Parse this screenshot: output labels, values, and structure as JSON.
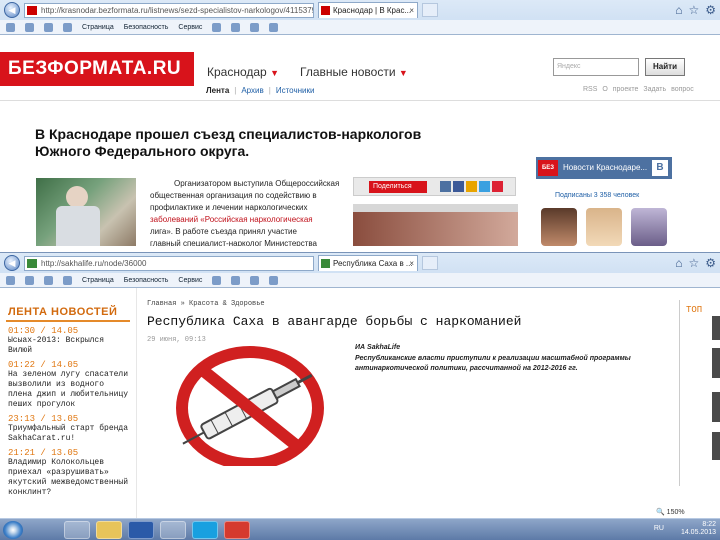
{
  "browser1": {
    "address": "http://krasnodar.bezformata.ru/listnews/sezd-specialistov-narkologov/4115379/",
    "tab_title": "Краснодар | В Крас...",
    "commands": [
      "Страница",
      "Безопасность",
      "Сервис"
    ]
  },
  "site1": {
    "logo": "БЕЗФОРМАТА.RU",
    "city": "Краснодар",
    "main_news": "Главные новости",
    "search_placeholder": "Яндекс",
    "search_button": "Найти",
    "subnav": [
      "Лента",
      "Архив",
      "Источники"
    ],
    "top_links": [
      "RSS",
      "О проекте",
      "Задать вопрос"
    ],
    "headline": "В Краснодаре прошел съезд специалистов-наркологов Южного Федерального округа.",
    "body_lines": [
      "Организатором выступила Общероссийская",
      "общественная организация по содействию в",
      "профилактике и лечении наркологических",
      "заболеваний «Российская наркологическая",
      "лига». В работе съезда принял участие",
      "главный специалист-нарколог Министерства"
    ],
    "share_label": "Поделиться",
    "vk_widget_title": "Новости Краснодаре...",
    "vk_logo_small": "БЕЗ",
    "vk_letter": "В",
    "subscribers": "Подписаны 3 358 человек"
  },
  "browser2": {
    "address": "http://sakhalife.ru/node/36000",
    "tab_title": "Республика Саха в ...",
    "commands": [
      "Страница",
      "Безопасность",
      "Сервис"
    ]
  },
  "site2": {
    "feed_title": "ЛЕНТА НОВОСТЕЙ",
    "feed": [
      {
        "time": "01:30 / 14.05",
        "text": "Ысыах-2013: Вскрылся Вилюй"
      },
      {
        "time": "01:22 / 14.05",
        "text": "На зеленом лугу спасатели вызволили из водного плена джип и любительницу пеших прогулок"
      },
      {
        "time": "23:13 / 13.05",
        "text": "Триумфальный старт бренда SakhaCarat.ru!"
      },
      {
        "time": "21:21 / 13.05",
        "text": "Владимир Колокольцев приехал «разрушивать» якутский межведомственный конклинт?"
      }
    ],
    "breadcrumbs": "Главная » Красота & Здоровье",
    "headline": "Республика Саха в авангарде борьбы с наркоманией",
    "date": "29 июня, 09:13",
    "source": "ИА SakhaLife",
    "lead": "Республиканские власти приступили к реализации масштабной программы антинаркотической политики, рассчитанной на 2012-2016 гг.",
    "right_title": "ТОП"
  },
  "status": {
    "zoom": "150%"
  },
  "taskbar": {
    "time": "8:22",
    "date": "14.05.2013",
    "lang": "RU"
  },
  "colors": {
    "brand_red": "#d8131b",
    "feed_orange": "#e07813",
    "vk_blue": "#4d71a1",
    "link_blue": "#1f5fa6"
  }
}
